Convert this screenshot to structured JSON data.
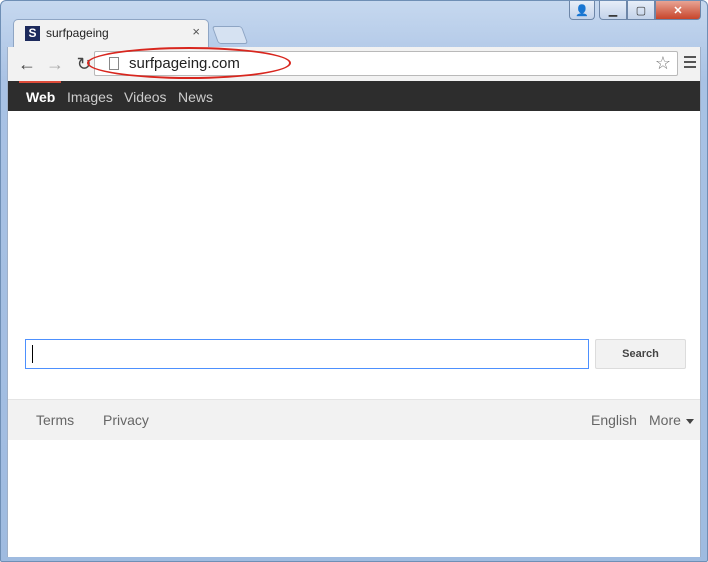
{
  "tab": {
    "favicon_letter": "S",
    "title": "surfpageing",
    "close": "×"
  },
  "window_controls": {
    "user": "👤",
    "minimize": "▁",
    "maximize": "▢",
    "close": "✕"
  },
  "toolbar": {
    "back": "←",
    "forward": "→",
    "reload": "↻",
    "url": "surfpageing.com",
    "star": "☆"
  },
  "nav": {
    "items": [
      {
        "label": "Web"
      },
      {
        "label": "Images"
      },
      {
        "label": "Videos"
      },
      {
        "label": "News"
      }
    ]
  },
  "search": {
    "placeholder": "",
    "value": "",
    "button_label": "Search"
  },
  "footer": {
    "terms": "Terms",
    "privacy": "Privacy",
    "language": "English",
    "more": "More"
  },
  "colors": {
    "accent": "#dd4b39",
    "annotation": "#d8261e",
    "focus": "#4d90fe",
    "nav_bg": "#2d2d2d"
  }
}
